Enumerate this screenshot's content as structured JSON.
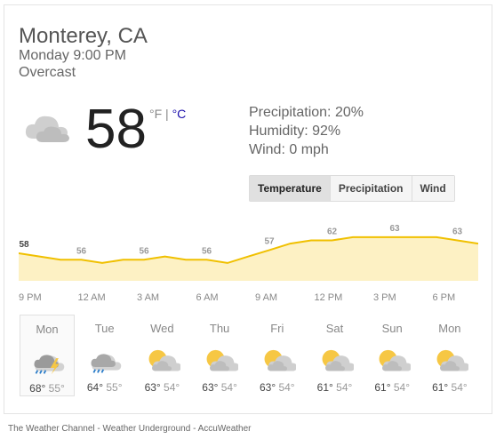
{
  "location": "Monterey, CA",
  "datetime": "Monday 9:00 PM",
  "condition": "Overcast",
  "current_icon": "cloudy-icon",
  "temperature": "58",
  "unit_f": "°F",
  "unit_sep": " | ",
  "unit_c": "°C",
  "details": {
    "precipitation": "Precipitation: 20%",
    "humidity": "Humidity: 92%",
    "wind": "Wind: 0 mph"
  },
  "tabs": [
    {
      "label": "Temperature",
      "active": true
    },
    {
      "label": "Precipitation",
      "active": false
    },
    {
      "label": "Wind",
      "active": false
    }
  ],
  "chart_data": {
    "type": "area",
    "series": [
      {
        "values": [
          58,
          57,
          56,
          56,
          55,
          56,
          56,
          57,
          56,
          56,
          55,
          57,
          59,
          61,
          62,
          62,
          63,
          63,
          63,
          63,
          63,
          62,
          61
        ]
      }
    ],
    "labels": [
      {
        "index": 0,
        "text": "58"
      },
      {
        "index": 3,
        "text": "56"
      },
      {
        "index": 6,
        "text": "56"
      },
      {
        "index": 9,
        "text": "56"
      },
      {
        "index": 12,
        "text": "57"
      },
      {
        "index": 15,
        "text": "62"
      },
      {
        "index": 18,
        "text": "63"
      },
      {
        "index": 21,
        "text": "63"
      }
    ],
    "x_labels": [
      "9 PM",
      "12 AM",
      "3 AM",
      "6 AM",
      "9 AM",
      "12 PM",
      "3 PM",
      "6 PM"
    ],
    "colors": {
      "line": "#f0c000",
      "fill": "#fdf1c4"
    }
  },
  "forecast": [
    {
      "day": "Mon",
      "hi": "68°",
      "lo": "55°",
      "icon": "thunderstorm-rain-icon",
      "selected": true
    },
    {
      "day": "Tue",
      "hi": "64°",
      "lo": "55°",
      "icon": "rain-cloud-icon",
      "selected": false
    },
    {
      "day": "Wed",
      "hi": "63°",
      "lo": "54°",
      "icon": "partly-cloudy-icon",
      "selected": false
    },
    {
      "day": "Thu",
      "hi": "63°",
      "lo": "54°",
      "icon": "partly-cloudy-icon",
      "selected": false
    },
    {
      "day": "Fri",
      "hi": "63°",
      "lo": "54°",
      "icon": "partly-cloudy-icon",
      "selected": false
    },
    {
      "day": "Sat",
      "hi": "61°",
      "lo": "54°",
      "icon": "partly-cloudy-icon",
      "selected": false
    },
    {
      "day": "Sun",
      "hi": "61°",
      "lo": "54°",
      "icon": "partly-cloudy-icon",
      "selected": false
    },
    {
      "day": "Mon",
      "hi": "61°",
      "lo": "54°",
      "icon": "partly-cloudy-icon",
      "selected": false
    }
  ],
  "footer": "The Weather Channel - Weather Underground - AccuWeather"
}
